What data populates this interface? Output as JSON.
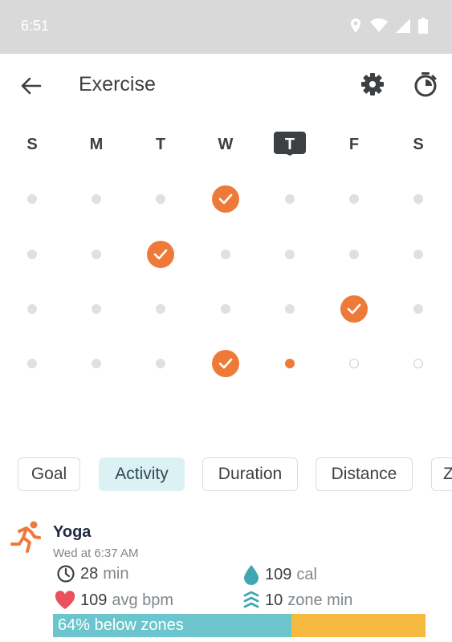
{
  "status": {
    "time": "6:51"
  },
  "header": {
    "title": "Exercise"
  },
  "week_days": [
    {
      "label": "S",
      "today": false
    },
    {
      "label": "M",
      "today": false
    },
    {
      "label": "T",
      "today": false
    },
    {
      "label": "W",
      "today": false
    },
    {
      "label": "T",
      "today": true
    },
    {
      "label": "F",
      "today": false
    },
    {
      "label": "S",
      "today": false
    }
  ],
  "calendar_rows": [
    [
      "dot",
      "dot",
      "dot",
      "check",
      "dot",
      "dot",
      "dot"
    ],
    [
      "dot",
      "dot",
      "check",
      "dot",
      "dot",
      "dot",
      "dot"
    ],
    [
      "dot",
      "dot",
      "dot",
      "dot",
      "dot",
      "check",
      "dot"
    ],
    [
      "dot",
      "dot",
      "dot",
      "check",
      "today",
      "future",
      "future"
    ]
  ],
  "chips": [
    {
      "label": "Goal",
      "active": false
    },
    {
      "label": "Activity",
      "active": true
    },
    {
      "label": "Duration",
      "active": false
    },
    {
      "label": "Distance",
      "active": false
    },
    {
      "label": "Z",
      "active": false
    }
  ],
  "entry": {
    "name": "Yoga",
    "time": "Wed at 6:37 AM",
    "duration_value": "28",
    "duration_unit": "min",
    "calories_value": "109",
    "calories_unit": "cal",
    "bpm_value": "109",
    "bpm_unit": "avg bpm",
    "zone_value": "10",
    "zone_unit": "zone min",
    "zone_label": "64% below zones",
    "below_zone_fraction": 0.64
  },
  "colors": {
    "accent": "#ee7a3a",
    "teal": "#6cc5cc",
    "zone": "#f6b93f"
  }
}
